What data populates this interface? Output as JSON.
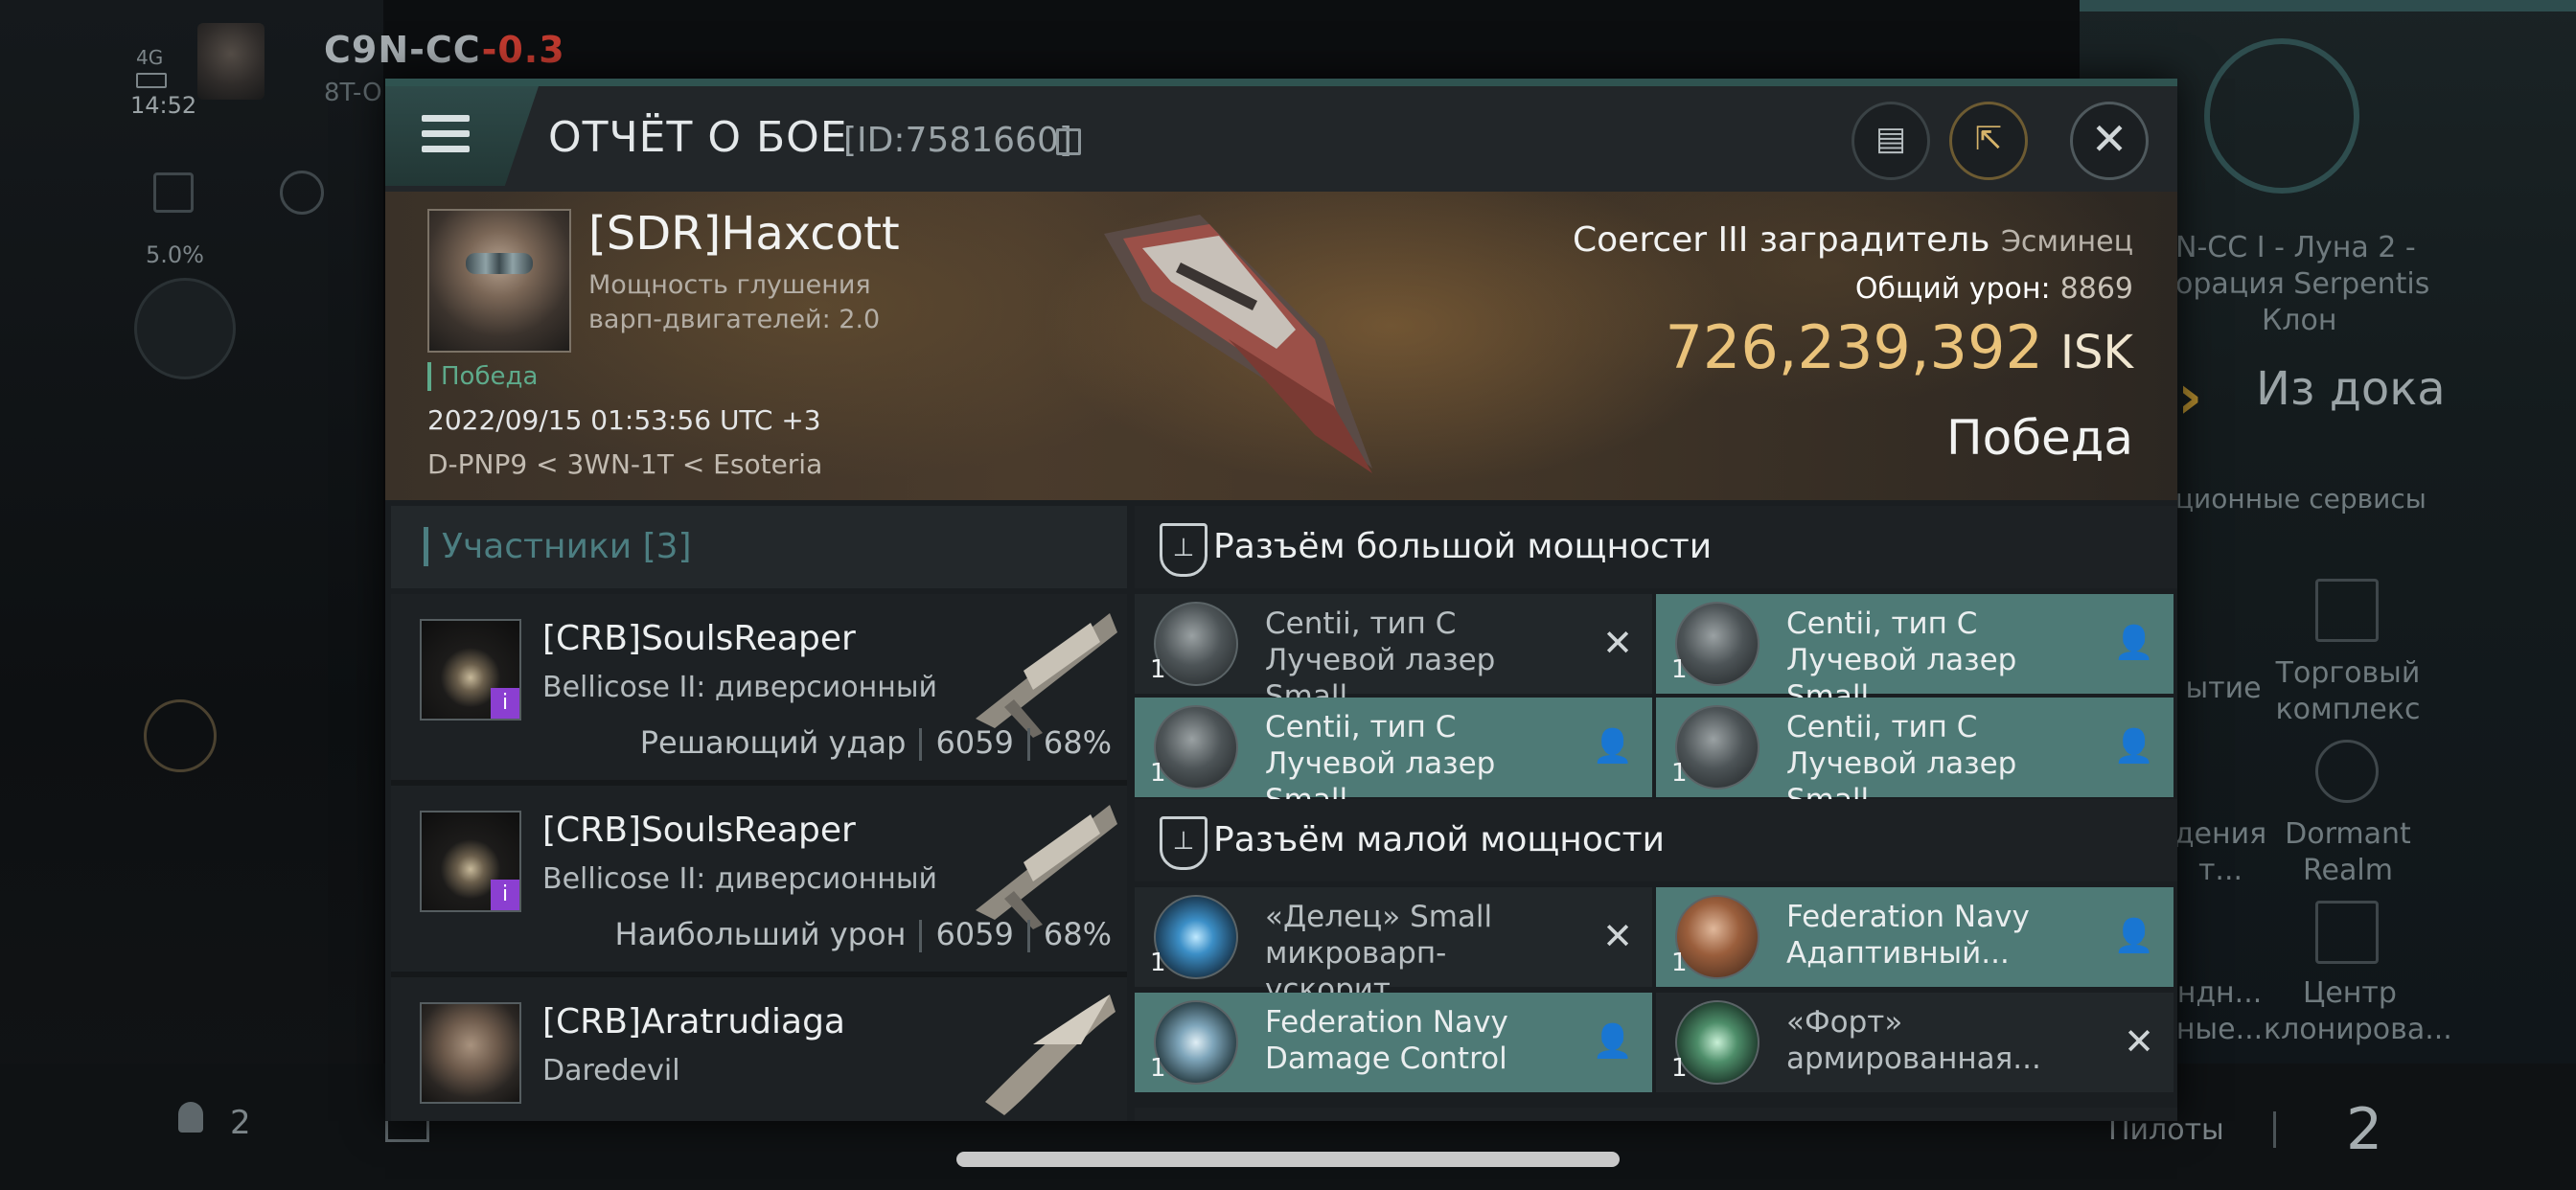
{
  "hud": {
    "signal": "4G",
    "time": "14:52",
    "system_name": "C9N-CC",
    "system_security": "-0.3",
    "system_sub": "8T-O",
    "cargo_percent": "5.0%",
    "station_lines": [
      "N-CC I - Луна 2 -",
      "орация Serpentis",
      "Клон"
    ],
    "undock_label": "Из дока",
    "services_label": "ционные сервисы",
    "service_tiles": [
      {
        "label": "ытие"
      },
      {
        "label": "Торговый комплекс"
      },
      {
        "label": "дения т..."
      },
      {
        "label": "Dormant Realm"
      },
      {
        "label": "ндн... ные..."
      },
      {
        "label": "Центр клонирова..."
      }
    ],
    "pilots_label": "Пилоты",
    "pilots_count": "2",
    "online_count": "2"
  },
  "report": {
    "title": "ОТЧЁТ О БОЕ",
    "id_text": "[ID:7581660]",
    "victim": {
      "name": "[SDR]Haxcott",
      "warp_line1": "Мощность глушения",
      "warp_line2": "варп-двигателей: 2.0",
      "result_small": "Победа",
      "datetime": "2022/09/15 01:53:56 UTC +3",
      "location": "D-PNP9 < 3WN-1T < Esoteria"
    },
    "ship": {
      "name": "Coercer III заградитель",
      "class": "Эсминец",
      "damage_label": "Общий урон:",
      "damage_value": "8869",
      "isk_value": "726,239,392",
      "isk_unit": "ISK",
      "result": "Победа"
    },
    "participants": {
      "title": "Участники",
      "count": "[3]",
      "rows": [
        {
          "name": "[CRB]SoulsReaper",
          "ship": "Bellicose II: диверсионный",
          "badge": "i",
          "role": "Решающий удар",
          "damage": "6059",
          "percent": "68%"
        },
        {
          "name": "[CRB]SoulsReaper",
          "ship": "Bellicose II: диверсионный",
          "badge": "i",
          "role": "Наибольший урон",
          "damage": "6059",
          "percent": "68%"
        },
        {
          "name": "[CRB]Aratrudiaga",
          "ship": "Daredevil"
        }
      ]
    },
    "high_slots": {
      "title": "Разъём большой мощности",
      "items": [
        {
          "name": "Centii, тип C Лучевой лазер Small",
          "qty": "1",
          "state": "destroyed"
        },
        {
          "name": "Centii, тип C Лучевой лазер Small",
          "qty": "1",
          "state": "dropped"
        },
        {
          "name": "Centii, тип C Лучевой лазер Small",
          "qty": "1",
          "state": "dropped"
        },
        {
          "name": "Centii, тип C Лучевой лазер Small",
          "qty": "1",
          "state": "dropped"
        }
      ]
    },
    "mid_slots": {
      "title": "Разъём малой мощности",
      "items": [
        {
          "name": "«Делец» Small микроварп-ускорит....",
          "qty": "1",
          "state": "destroyed"
        },
        {
          "name": "Federation Navy Адаптивный...",
          "qty": "1",
          "state": "dropped"
        },
        {
          "name": "Federation Navy Damage Control",
          "qty": "1",
          "state": "dropped"
        },
        {
          "name": "«Форт» армированная...",
          "qty": "1",
          "state": "destroyed"
        }
      ]
    },
    "colors": {
      "accent_teal": "#4e7a76",
      "isk_gold": "#e9c27a",
      "security_red": "#c23a2f",
      "badge_purple": "#8b3fd1"
    },
    "icons": {
      "menu": "hamburger-icon",
      "notes": "clipboard-icon",
      "share": "share-icon",
      "close": "close-icon",
      "destroyed": "x-mark-icon",
      "dropped": "person-icon"
    }
  }
}
